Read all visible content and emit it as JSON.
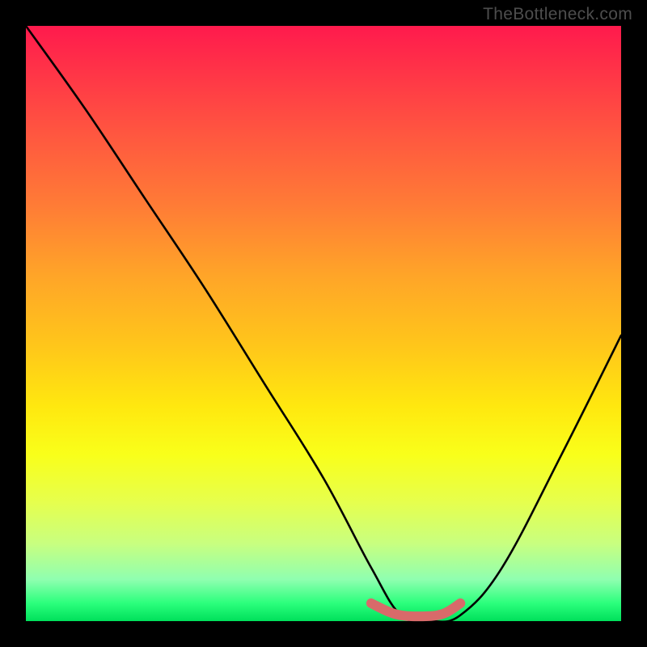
{
  "watermark": "TheBottleneck.com",
  "chart_data": {
    "type": "line",
    "title": "",
    "xlabel": "",
    "ylabel": "",
    "xlim": [
      0,
      100
    ],
    "ylim": [
      0,
      100
    ],
    "series": [
      {
        "name": "bottleneck-curve",
        "x": [
          0,
          10,
          20,
          30,
          40,
          50,
          58,
          63,
          68,
          73,
          80,
          90,
          100
        ],
        "values": [
          100,
          86,
          71,
          56,
          40,
          24,
          9,
          1,
          0,
          1,
          9,
          28,
          48
        ]
      }
    ],
    "valley_marker": {
      "name": "optimal-range",
      "color": "#d86a6a",
      "x": [
        58,
        62,
        66,
        70,
        73
      ],
      "values": [
        3.0,
        1.2,
        0.8,
        1.2,
        3.0
      ]
    }
  }
}
